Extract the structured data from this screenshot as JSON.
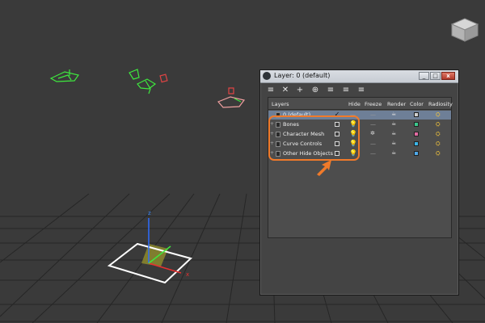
{
  "dialog": {
    "title": "Layer: 0 (default)",
    "buttons": {
      "minimize": "_",
      "maximize": "□",
      "close": "x"
    }
  },
  "toolbar": {
    "icons": [
      "create-layer-icon",
      "delete-layer-icon",
      "add-to-layer-icon",
      "select-in-layer-icon",
      "highlight-layer-icon",
      "hide-all-icon",
      "freeze-all-icon"
    ],
    "glyphs": [
      "≡",
      "✕",
      "+",
      "⊕",
      "≡",
      "≡",
      "≡"
    ]
  },
  "columns": {
    "layers": "Layers",
    "hide": "Hide",
    "freeze": "Freeze",
    "render": "Render",
    "color": "Color",
    "radiosity": "Radiosity"
  },
  "rows": [
    {
      "name": "0 (default)",
      "selected": true,
      "active_mark": "✓",
      "hide": "—",
      "freeze": "—",
      "color": "#d0d0d0"
    },
    {
      "name": "Bones",
      "selected": false,
      "hide": "box",
      "freeze": "—",
      "color": "#3cc88c"
    },
    {
      "name": "Character Mesh",
      "selected": false,
      "hide": "box",
      "freeze": "✲",
      "color": "#e06aa0"
    },
    {
      "name": "Curve Controls",
      "selected": false,
      "hide": "box",
      "freeze": "—",
      "color": "#3cb4e6"
    },
    {
      "name": "Other Hide Objects",
      "selected": false,
      "hide": "box",
      "freeze": "—",
      "color": "#4fa8e8"
    }
  ],
  "cell_glyphs": {
    "render": "☕",
    "hide_on": "💡",
    "radiosity": "⛭",
    "toggle": "+"
  },
  "colors": {
    "highlight": "#f07a2a",
    "selection": "#6e7f97"
  }
}
